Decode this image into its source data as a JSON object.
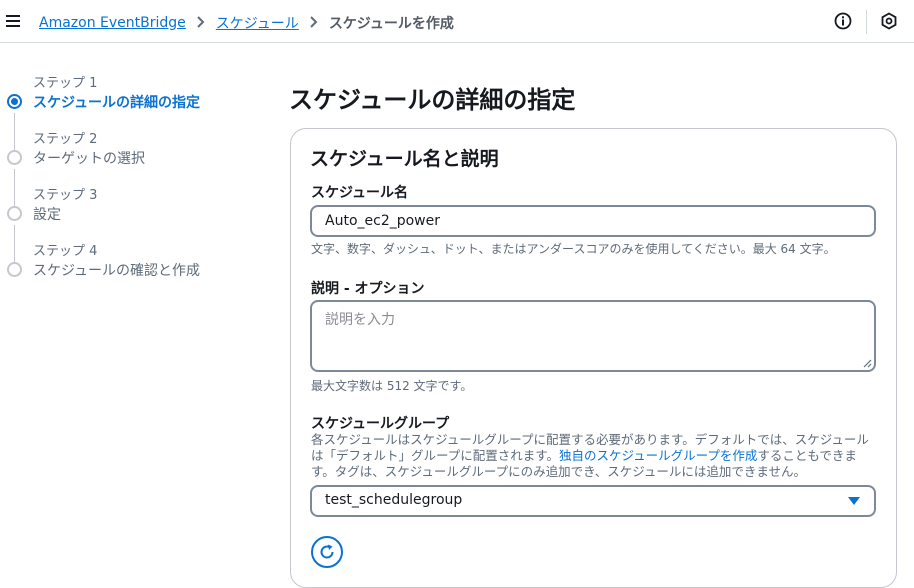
{
  "header": {
    "breadcrumbs": [
      "Amazon EventBridge",
      "スケジュール"
    ],
    "current": "スケジュールを作成",
    "icons": [
      "menu-icon",
      "info-icon",
      "settings-icon"
    ]
  },
  "steps": [
    {
      "num": "ステップ 1",
      "title": "スケジュールの詳細の指定",
      "active": true
    },
    {
      "num": "ステップ 2",
      "title": "ターゲットの選択",
      "active": false
    },
    {
      "num": "ステップ 3",
      "title": "設定",
      "active": false
    },
    {
      "num": "ステップ 4",
      "title": "スケジュールの確認と作成",
      "active": false
    }
  ],
  "page": {
    "title": "スケジュールの詳細の指定",
    "card_title": "スケジュール名と説明"
  },
  "form": {
    "name_label": "スケジュール名",
    "name_value": "Auto_ec2_power",
    "name_hint": "文字、数字、ダッシュ、ドット、またはアンダースコアのみを使用してください。最大 64 文字。",
    "desc_label": "説明 - オプション",
    "desc_placeholder": "説明を入力",
    "desc_hint": "最大文字数は 512 文字です。",
    "group_label": "スケジュールグループ",
    "group_desc_1": "各スケジュールはスケジュールグループに配置する必要があります。デフォルトでは、スケジュールは「デフォルト」グループに配置されます。",
    "group_desc_link": "独自のスケジュールグループを作成",
    "group_desc_2": "することもできます。タグは、スケジュールグループにのみ追加でき、スケジュールには追加できません。",
    "group_value": "test_schedulegroup"
  },
  "colors": {
    "accent": "#0972d3",
    "border": "#7d8998",
    "muted": "#5f6b7a"
  }
}
